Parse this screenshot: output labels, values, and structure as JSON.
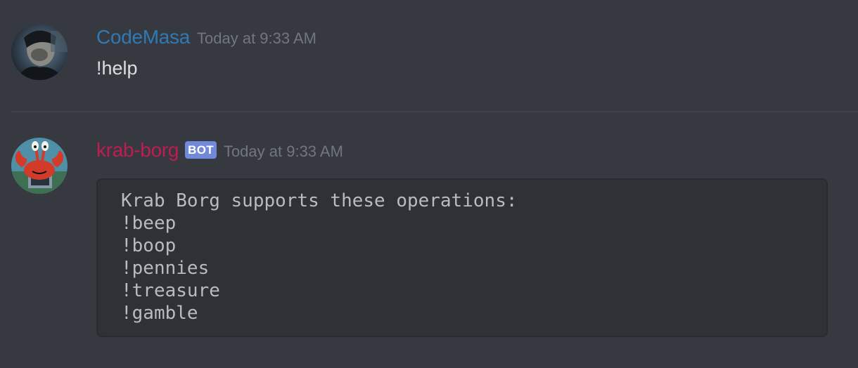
{
  "messages": [
    {
      "username": "CodeMasa",
      "timestamp": "Today at 9:33 AM",
      "text": "!help",
      "avatar_icon": "user-photo-avatar",
      "username_color": "#2f7ab4"
    },
    {
      "username": "krab-borg",
      "badge": "BOT",
      "timestamp": "Today at 9:33 AM",
      "avatar_icon": "mr-krabs-avatar",
      "username_color": "#c21b52",
      "code_lines": [
        "Krab Borg supports these operations:",
        "!beep",
        "!boop",
        "!pennies",
        "!treasure",
        "!gamble"
      ]
    }
  ],
  "colors": {
    "background": "#36393f",
    "codeblock_background": "#2f3136",
    "bot_badge": "#7289da",
    "timestamp": "#72767d"
  }
}
